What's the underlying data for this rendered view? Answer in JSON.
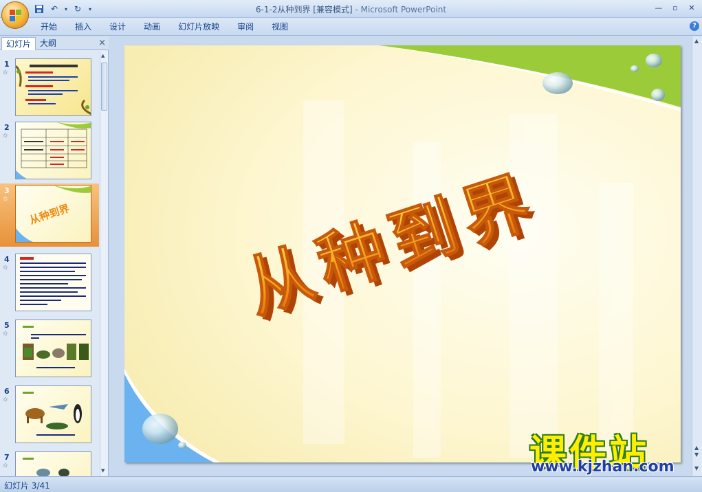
{
  "window": {
    "title_prefix": "6-1-2从种到界 [兼容模式]",
    "title_suffix": " - Microsoft PowerPoint",
    "controls": [
      "—",
      "▫",
      "✕"
    ]
  },
  "ribbon": {
    "tabs": [
      "开始",
      "插入",
      "设计",
      "动画",
      "幻灯片放映",
      "审阅",
      "视图"
    ],
    "help": "?"
  },
  "left_pane": {
    "tab_slides": "幻灯片",
    "tab_outline": "大纲",
    "close": "×",
    "slide_numbers": [
      "1",
      "2",
      "3",
      "4",
      "5",
      "6",
      "7"
    ],
    "active_index": 3
  },
  "slide": {
    "title": "从种到界",
    "colors": {
      "accent_green": "#9ccb3a",
      "accent_blue": "#6bb3f0",
      "title_orange": "#f08a10"
    }
  },
  "watermark": {
    "cn": "课件站",
    "url": "www.kjzhan.com"
  },
  "status_bar": {
    "slide_info": "幻灯片 3/41"
  }
}
